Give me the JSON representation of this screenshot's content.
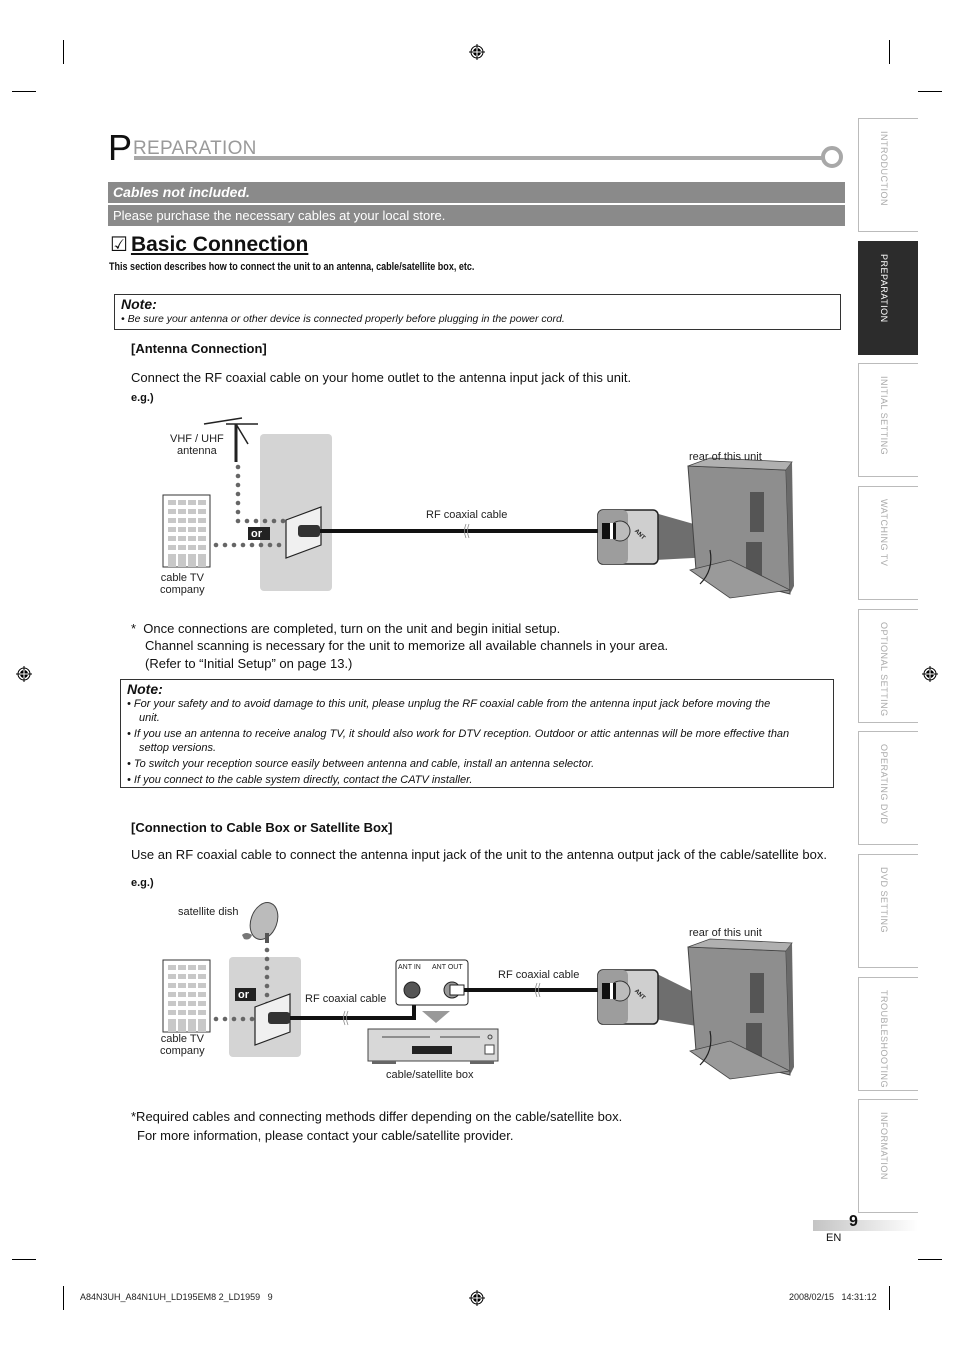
{
  "header": {
    "title_initial": "P",
    "title_rest": "REPARATION"
  },
  "banner": {
    "heading": "Cables not included.",
    "text": "Please purchase the necessary cables at your local store."
  },
  "section": {
    "checkbox_glyph": "☑",
    "title": "Basic Connection",
    "description": "This section describes how to connect the unit to an antenna, cable/satellite box, etc."
  },
  "note1": {
    "title": "Note:",
    "items": [
      "• Be sure your antenna or other device is connected properly before plugging in the power cord."
    ]
  },
  "antenna": {
    "heading": "[Antenna Connection]",
    "instruction": "Connect the RF coaxial cable on your home outlet to the antenna input jack of this unit.",
    "eg": "e.g.)",
    "diagram": {
      "antenna_label": [
        "VHF / UHF",
        "antenna"
      ],
      "cable_company_label": [
        "cable TV",
        "company"
      ],
      "or_label": "or",
      "cable_label": "RF coaxial cable",
      "rear_label": "rear of this unit",
      "jack_label": "ANT"
    },
    "footnote": [
      "*  Once connections are completed, turn on the unit and begin initial setup.",
      "Channel scanning is necessary for the unit to memorize all available channels in your area.",
      "(Refer to “Initial Setup” on page 13.)"
    ]
  },
  "note2": {
    "title": "Note:",
    "items": [
      "•  For your safety and to avoid damage to this unit, please unplug the RF coaxial cable from the antenna input jack before moving the",
      "unit.",
      "•  If you use an antenna to receive analog TV, it should also work for DTV reception. Outdoor or attic antennas will be more effective than",
      "settop versions.",
      "• To switch your reception source easily between antenna and cable, install an antenna selector.",
      "• If you connect to the cable system directly, contact the CATV installer."
    ]
  },
  "cablebox": {
    "heading": "[Connection to Cable Box or Satellite Box]",
    "instruction": "Use an RF coaxial cable to connect the antenna input jack of the unit to the antenna output jack of the cable/satellite box.",
    "eg": "e.g.)",
    "diagram": {
      "dish_label": "satellite dish",
      "cable_company_label": [
        "cable TV",
        "company"
      ],
      "or_label": "or",
      "cable_label_left": "RF coaxial cable",
      "cable_label_right": "RF coaxial cable",
      "ant_in": "ANT IN",
      "ant_out": "ANT OUT",
      "box_label": "cable/satellite box",
      "rear_label": "rear of this unit",
      "jack_label": "ANT"
    },
    "footnote": [
      "*Required cables and connecting methods differ depending on the cable/satellite box.",
      "For more information, please contact your cable/satellite provider."
    ]
  },
  "sidebar": {
    "tabs": [
      {
        "label": "INTRODUCTION",
        "active": false
      },
      {
        "label": "PREPARATION",
        "active": true
      },
      {
        "label": "INITIAL  SETTING",
        "active": false
      },
      {
        "label": "WATCHING  TV",
        "active": false
      },
      {
        "label": "OPTIONAL  SETTING",
        "active": false
      },
      {
        "label": "OPERATING  DVD",
        "active": false
      },
      {
        "label": "DVD  SETTING",
        "active": false
      },
      {
        "label": "TROUBLESHOOTING",
        "active": false
      },
      {
        "label": "INFORMATION",
        "active": false
      }
    ]
  },
  "page": {
    "number": "9",
    "language": "EN"
  },
  "footer": {
    "file": "A84N3UH_A84N1UH_LD195EM8 2_LD1959   9",
    "timestamp": "2008/02/15   14:31:12"
  }
}
